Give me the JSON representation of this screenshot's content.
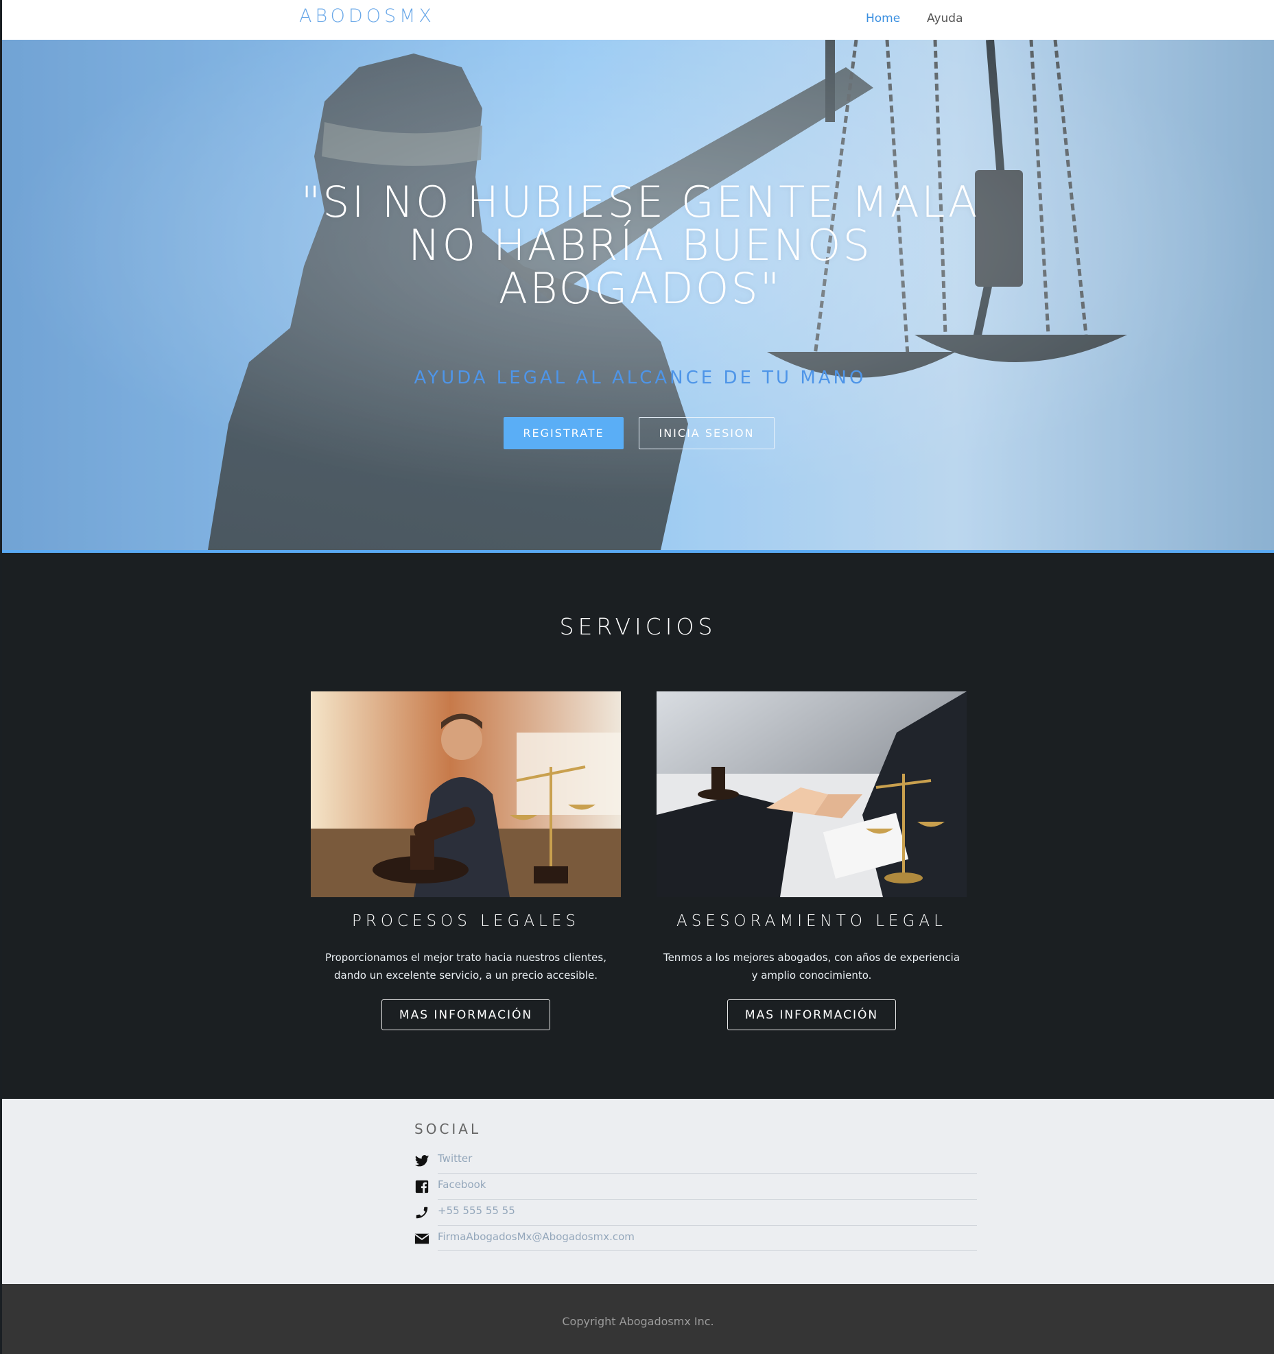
{
  "nav": {
    "brand": "ABODOSMX",
    "links": [
      {
        "label": "Home",
        "active": true
      },
      {
        "label": "Ayuda",
        "active": false
      }
    ]
  },
  "hero": {
    "quote_line1": "\"SI NO HUBIESE GENTE MALA",
    "quote_line2": "NO HABRÍA BUENOS",
    "quote_line3": "ABOGADOS\"",
    "subtitle": "AYUDA LEGAL AL ALCANCE DE TU MANO",
    "register_label": "REGISTRATE",
    "login_label": "INICIA SESION",
    "image_icon": "lady-justice-scales-image"
  },
  "services": {
    "title": "SERVICIOS",
    "cards": [
      {
        "title": "PROCESOS LEGALES",
        "text": "Proporcionamos el mejor trato hacia nuestros clientes, dando un excelente servicio, a un precio accesible.",
        "button": "MAS INFORMACIÓN",
        "image_icon": "lawyer-gavel-image"
      },
      {
        "title": "ASESORAMIENTO LEGAL",
        "text": "Tenmos a los mejores abogados, con años de experiencia y amplio conocimiento.",
        "button": "MAS INFORMACIÓN",
        "image_icon": "handshake-scales-image"
      }
    ]
  },
  "social": {
    "title": "SOCIAL",
    "items": [
      {
        "icon": "twitter-icon",
        "label": "Twitter"
      },
      {
        "icon": "facebook-icon",
        "label": "Facebook"
      },
      {
        "icon": "phone-icon",
        "label": "+55 555 55 55"
      },
      {
        "icon": "mail-icon",
        "label": "FirmaAbogadosMx@Abogadosmx.com"
      }
    ]
  },
  "footer": {
    "copyright": "Copyright Abogadosmx Inc."
  },
  "colors": {
    "accent": "#5aaef6",
    "nav_active": "#3a8fe0",
    "services_bg": "#1b1f22",
    "social_bg": "#eceef1",
    "footer_bg": "#353535"
  }
}
